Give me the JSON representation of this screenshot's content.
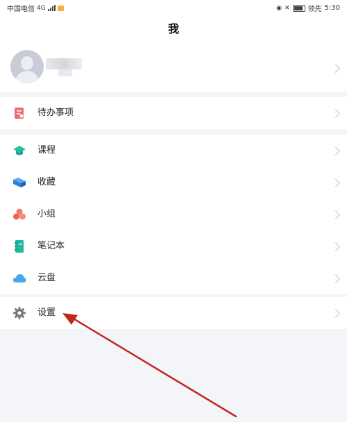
{
  "status_bar": {
    "carrier": "中国电信",
    "carrier_net": "4G",
    "right_text": "领先",
    "time": "5:30"
  },
  "header": {
    "title": "我"
  },
  "profile": {
    "avatar_icon": "default-avatar-icon",
    "chevron_icon": "chevron-right-icon"
  },
  "menu": {
    "todo": {
      "label": "待办事项",
      "icon": "todo-icon",
      "color": "#f06b6b"
    },
    "course": {
      "label": "课程",
      "icon": "graduation-cap-icon",
      "color": "#22c1a3"
    },
    "favorites": {
      "label": "收藏",
      "icon": "folder-icon",
      "color": "#3a8ee6"
    },
    "group": {
      "label": "小组",
      "icon": "group-icon",
      "color": "#f37a6e"
    },
    "notebook": {
      "label": "笔记本",
      "icon": "notebook-icon",
      "color": "#20b8a0"
    },
    "cloud": {
      "label": "云盘",
      "icon": "cloud-icon",
      "color": "#4aa6ea"
    },
    "settings": {
      "label": "设置",
      "icon": "gear-icon",
      "color": "#777777"
    }
  },
  "annotation": {
    "arrow_color": "#c0281e"
  }
}
